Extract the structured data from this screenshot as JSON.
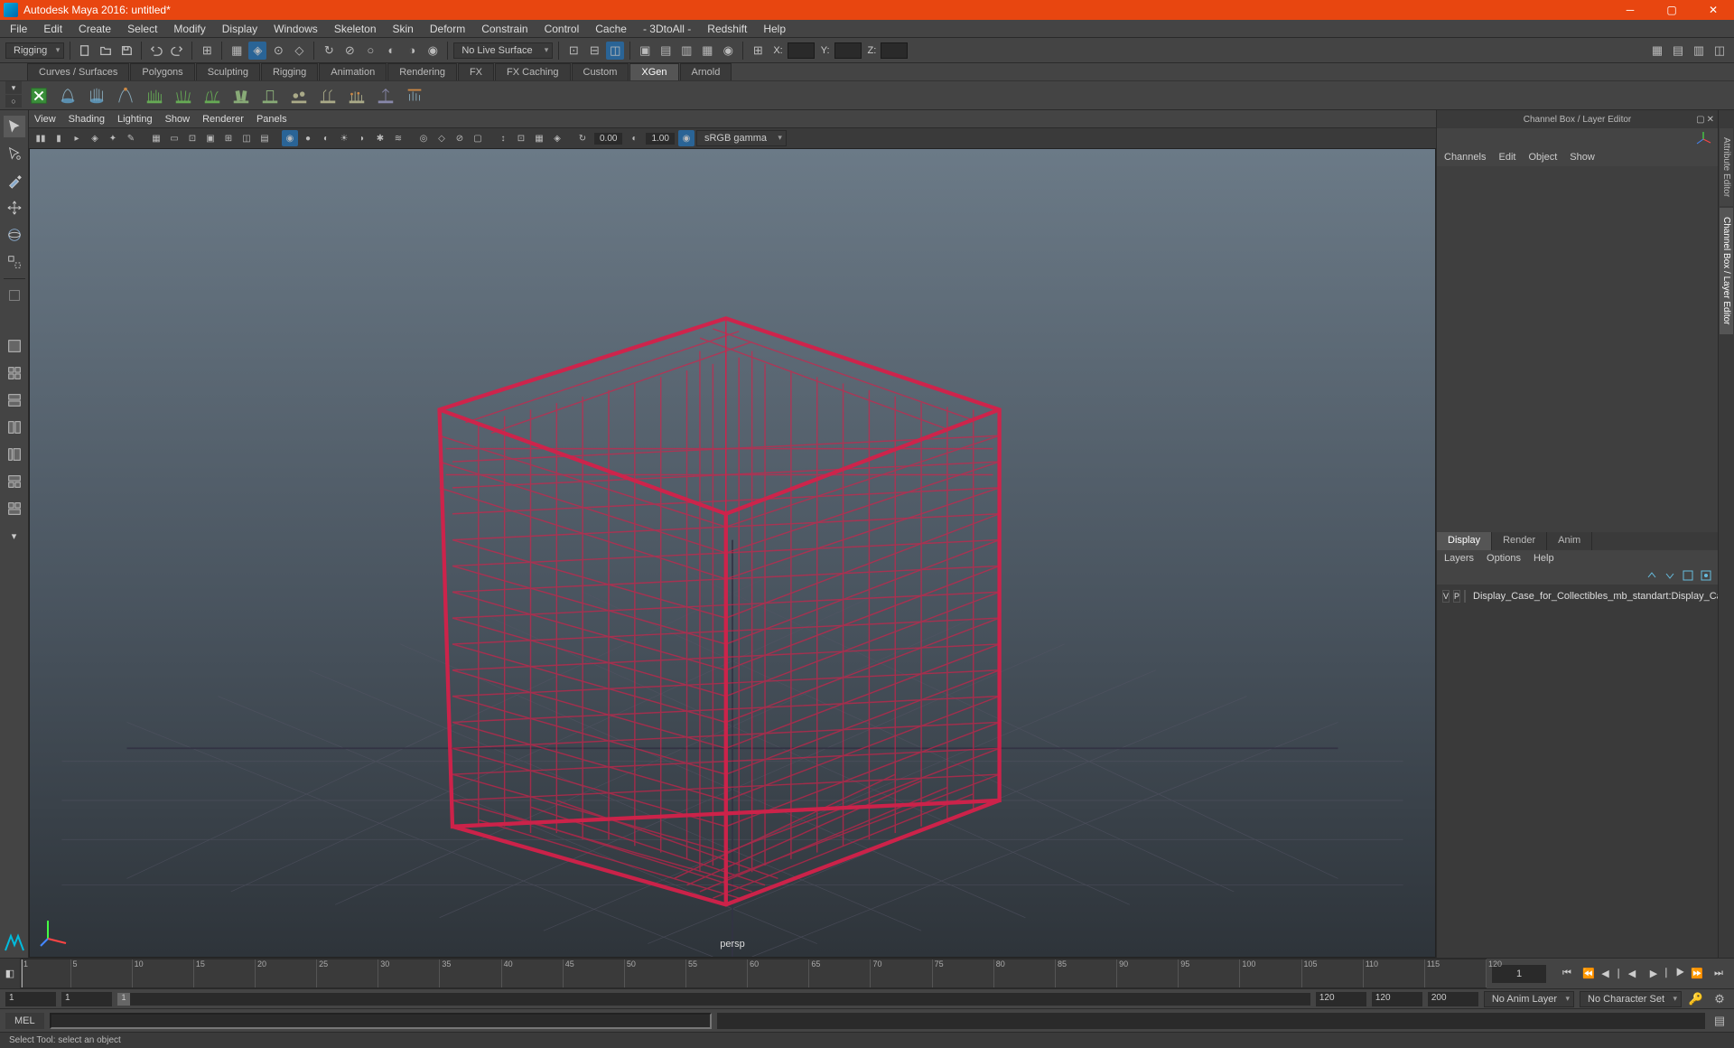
{
  "title": "Autodesk Maya 2016: untitled*",
  "menus": [
    "File",
    "Edit",
    "Create",
    "Select",
    "Modify",
    "Display",
    "Windows",
    "Skeleton",
    "Skin",
    "Deform",
    "Constrain",
    "Control",
    "Cache",
    "- 3DtoAll -",
    "Redshift",
    "Help"
  ],
  "mode_dropdown": "Rigging",
  "live_surface": "No Live Surface",
  "coord_labels": [
    "X:",
    "Y:",
    "Z:"
  ],
  "shelf_tabs": [
    "Curves / Surfaces",
    "Polygons",
    "Sculpting",
    "Rigging",
    "Animation",
    "Rendering",
    "FX",
    "FX Caching",
    "Custom",
    "XGen",
    "Arnold"
  ],
  "shelf_active": "XGen",
  "panel_menus": [
    "View",
    "Shading",
    "Lighting",
    "Show",
    "Renderer",
    "Panels"
  ],
  "panel_val1": "0.00",
  "panel_val2": "1.00",
  "panel_colorspace": "sRGB gamma",
  "viewport_camera": "persp",
  "channel_box_title": "Channel Box / Layer Editor",
  "cb_menus": [
    "Channels",
    "Edit",
    "Object",
    "Show"
  ],
  "layer_tabs": [
    "Display",
    "Render",
    "Anim"
  ],
  "layer_menus": [
    "Layers",
    "Options",
    "Help"
  ],
  "layer_item": "Display_Case_for_Collectibles_mb_standart:Display_Case",
  "layer_v": "V",
  "layer_p": "P",
  "vert_tabs": [
    "Attribute Editor",
    "Channel Box / Layer Editor"
  ],
  "time_start": "1",
  "time_end_box": "1",
  "range_start": "1",
  "range_start2": "1",
  "range_slider_val": "1",
  "range_end1": "120",
  "range_end2": "120",
  "range_end3": "200",
  "anim_layer": "No Anim Layer",
  "char_set": "No Character Set",
  "cmd_lang": "MEL",
  "status_text": "Select Tool: select an object",
  "ticks": [
    1,
    5,
    10,
    15,
    20,
    25,
    30,
    35,
    40,
    45,
    50,
    55,
    60,
    65,
    70,
    75,
    80,
    85,
    90,
    95,
    100,
    105,
    110,
    115,
    120
  ]
}
